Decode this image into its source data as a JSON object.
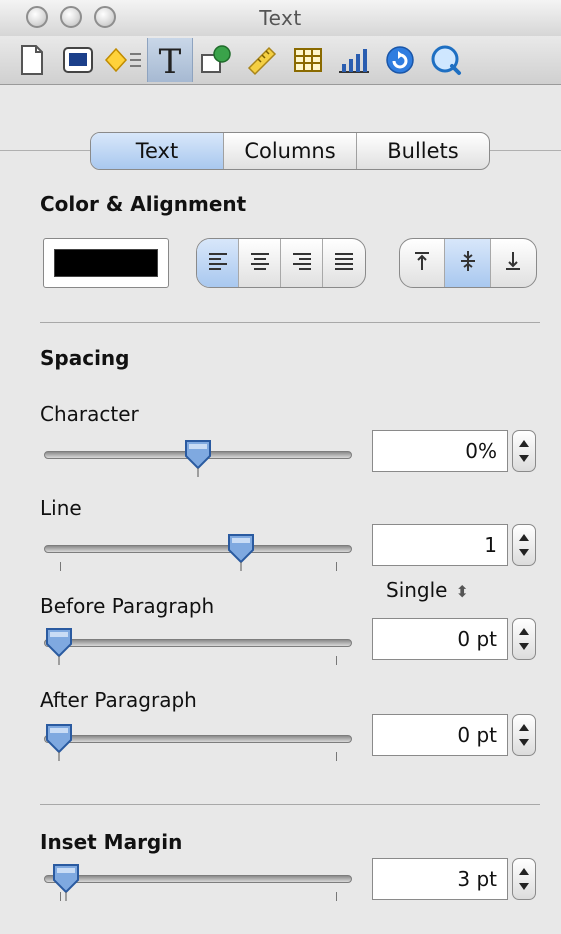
{
  "window": {
    "title": "Text"
  },
  "toolbar": {
    "buttons": [
      {
        "icon": "document-icon"
      },
      {
        "icon": "graphic-icon"
      },
      {
        "icon": "metrics-icon"
      },
      {
        "icon": "text-icon",
        "active": true
      },
      {
        "icon": "shape-icon"
      },
      {
        "icon": "ruler-icon"
      },
      {
        "icon": "table-icon"
      },
      {
        "icon": "chart-icon"
      },
      {
        "icon": "link-icon"
      },
      {
        "icon": "quicktime-icon"
      }
    ]
  },
  "tabs": [
    {
      "label": "Text",
      "selected": true
    },
    {
      "label": "Columns",
      "selected": false
    },
    {
      "label": "Bullets",
      "selected": false
    }
  ],
  "color_alignment": {
    "heading": "Color & Alignment",
    "text_color": "#000000",
    "horizontal_alignment": {
      "options": [
        "left",
        "center",
        "right",
        "justify"
      ],
      "selected": "left"
    },
    "vertical_alignment": {
      "options": [
        "top",
        "middle",
        "bottom"
      ],
      "selected": "middle"
    }
  },
  "spacing": {
    "heading": "Spacing",
    "character": {
      "label": "Character",
      "value": "0%",
      "slider_fraction": 0.5
    },
    "line": {
      "label": "Line",
      "value": "1",
      "mode": "Single",
      "slider_fraction": 0.64
    },
    "before_paragraph": {
      "label": "Before Paragraph",
      "value": "0 pt",
      "slider_fraction": 0.05
    },
    "after_paragraph": {
      "label": "After Paragraph",
      "value": "0 pt",
      "slider_fraction": 0.05
    }
  },
  "inset_margin": {
    "heading": "Inset Margin",
    "value": "3 pt",
    "slider_fraction": 0.07
  }
}
